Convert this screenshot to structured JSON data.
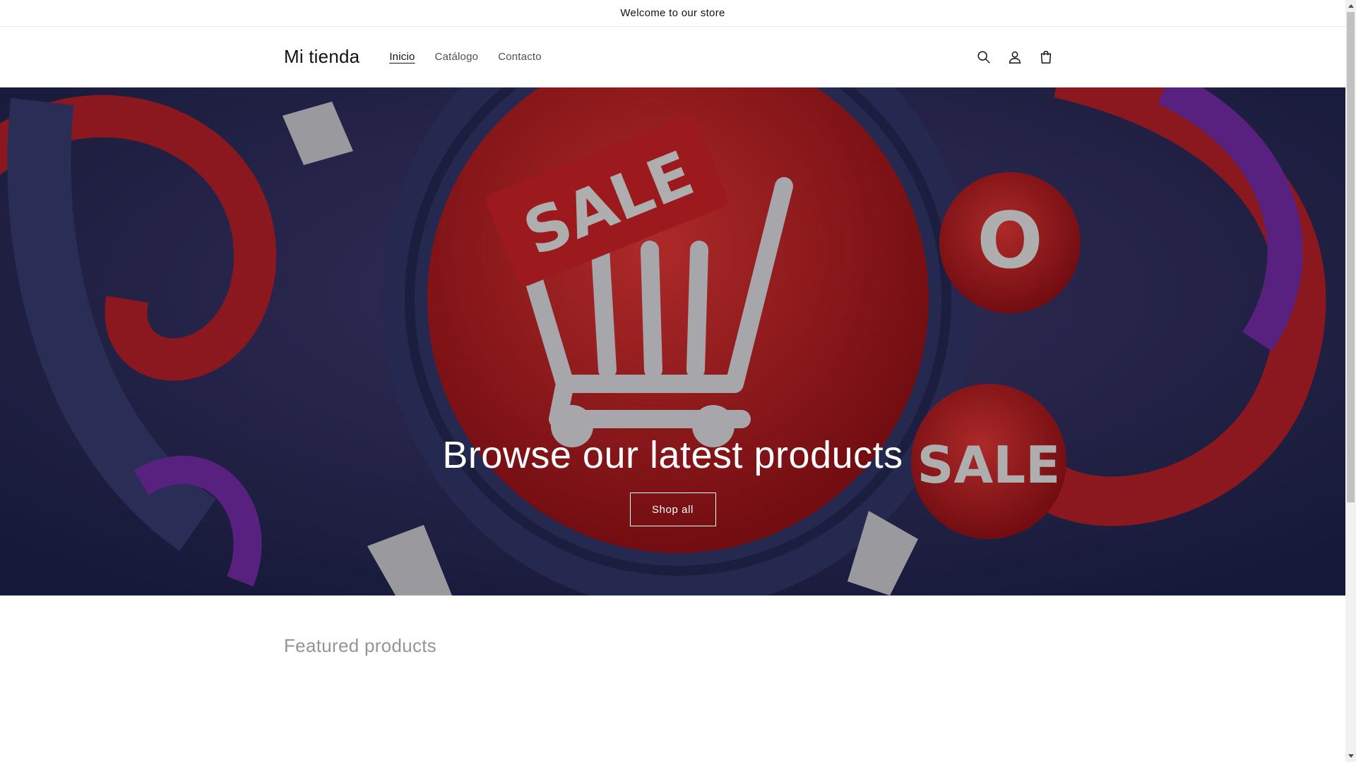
{
  "announcement": {
    "text": "Welcome to our store"
  },
  "header": {
    "logo": "Mi tienda",
    "nav": [
      {
        "label": "Inicio",
        "active": true
      },
      {
        "label": "Catálogo",
        "active": false
      },
      {
        "label": "Contacto",
        "active": false
      }
    ],
    "icons": [
      "search-icon",
      "account-icon",
      "cart-icon"
    ]
  },
  "hero": {
    "title": "Browse our latest products",
    "button_label": "Shop all",
    "image_text": [
      "SALE",
      "SALE",
      "O"
    ]
  },
  "featured": {
    "title": "Featured products"
  },
  "colors": {
    "text": "#121212",
    "hero_red": "#d8232a",
    "hero_navy": "#343a6e",
    "hero_purple": "#7a2fb0"
  }
}
